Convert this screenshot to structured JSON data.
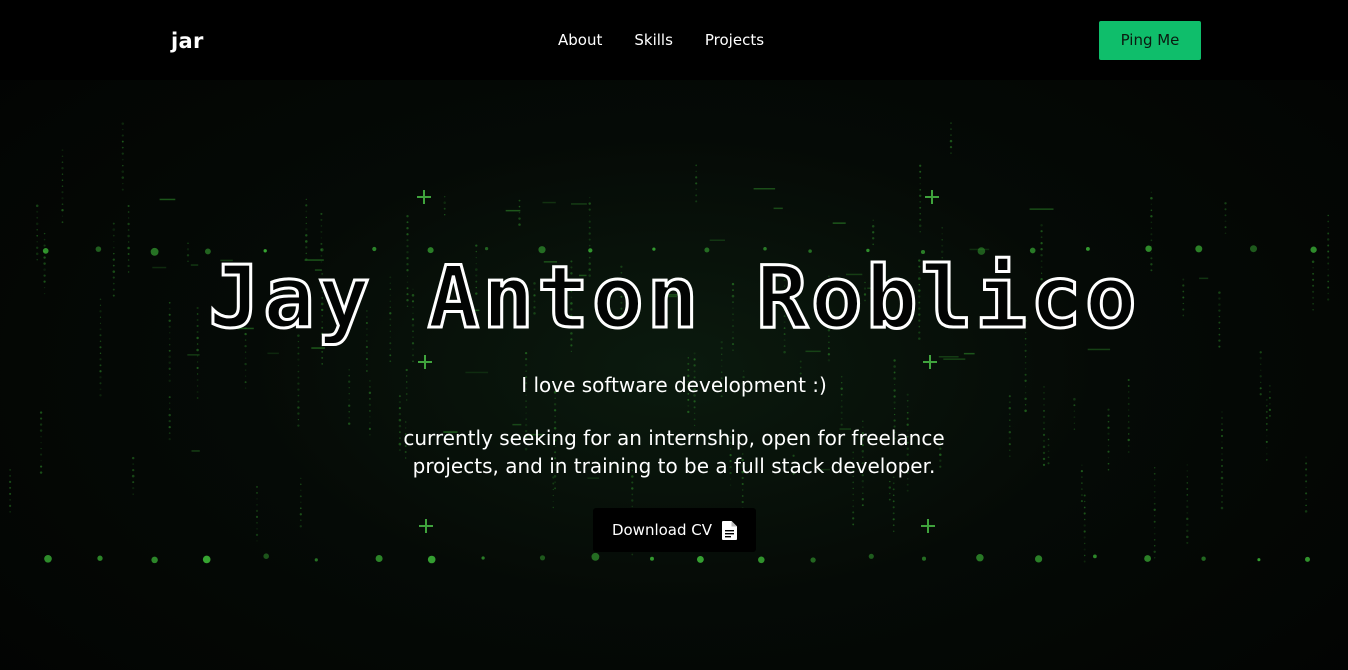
{
  "nav": {
    "brand": "jar",
    "links": [
      {
        "label": "About"
      },
      {
        "label": "Skills"
      },
      {
        "label": "Projects"
      }
    ],
    "cta_label": "Ping Me"
  },
  "hero": {
    "title": "Jay Anton Roblico",
    "subtitle": "I love software development :)",
    "description": "currently seeking for an internship, open for freelance projects, and in training to be a full stack developer.",
    "cv_button_label": "Download CV",
    "cv_icon": "file-document-icon"
  },
  "colors": {
    "accent": "#0fbe6b",
    "background": "#020403",
    "navbar": "#000000",
    "text": "#ffffff",
    "matrix_green": "#2f8f2a"
  }
}
